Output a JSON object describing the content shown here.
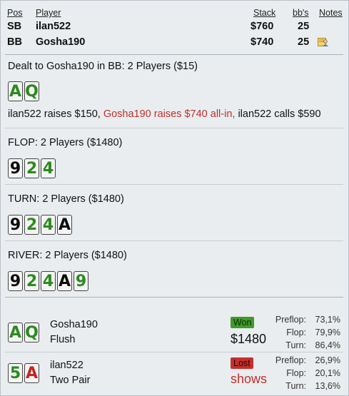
{
  "header": {
    "pos": "Pos",
    "player": "Player",
    "stack": "Stack",
    "bbs": "bb's",
    "notes": "Notes"
  },
  "players": [
    {
      "pos": "SB",
      "name": "ilan522",
      "stack": "$760",
      "bbs": "25"
    },
    {
      "pos": "BB",
      "name": "Gosha190",
      "stack": "$740",
      "bbs": "25",
      "note_icon": "note-person-icon"
    }
  ],
  "preflop": {
    "title": "Dealt to Gosha190 in BB: 2 Players ($15)",
    "hole_cards": [
      {
        "rank": "A",
        "suit": "club"
      },
      {
        "rank": "Q",
        "suit": "club"
      }
    ],
    "action_1": "ilan522 raises $150, ",
    "action_2": "Gosha190 raises $740 all-in, ",
    "action_3": "ilan522 calls $590"
  },
  "flop": {
    "title": "FLOP: 2 Players ($1480)",
    "cards": [
      {
        "rank": "9",
        "suit": "spade"
      },
      {
        "rank": "2",
        "suit": "club"
      },
      {
        "rank": "4",
        "suit": "club"
      }
    ]
  },
  "turn": {
    "title": "TURN: 2 Players ($1480)",
    "cards": [
      {
        "rank": "9",
        "suit": "spade"
      },
      {
        "rank": "2",
        "suit": "club"
      },
      {
        "rank": "4",
        "suit": "club"
      },
      {
        "rank": "A",
        "suit": "spade"
      }
    ]
  },
  "river": {
    "title": "RIVER: 2 Players ($1480)",
    "cards": [
      {
        "rank": "9",
        "suit": "spade"
      },
      {
        "rank": "2",
        "suit": "club"
      },
      {
        "rank": "4",
        "suit": "club"
      },
      {
        "rank": "A",
        "suit": "spade"
      },
      {
        "rank": "9",
        "suit": "club"
      }
    ]
  },
  "results": [
    {
      "cards": [
        {
          "rank": "A",
          "suit": "club"
        },
        {
          "rank": "Q",
          "suit": "club"
        }
      ],
      "name": "Gosha190",
      "hand": "Flush",
      "badge": "Won",
      "amount": "$1480",
      "stats": [
        {
          "k": "Preflop:",
          "v": "73,1%"
        },
        {
          "k": "Flop:",
          "v": "79,9%"
        },
        {
          "k": "Turn:",
          "v": "86,4%"
        }
      ]
    },
    {
      "cards": [
        {
          "rank": "5",
          "suit": "club"
        },
        {
          "rank": "A",
          "suit": "heart"
        }
      ],
      "name": "ilan522",
      "hand": "Two Pair",
      "badge": "Lost",
      "amount": "shows",
      "stats": [
        {
          "k": "Preflop:",
          "v": "26,9%"
        },
        {
          "k": "Flop:",
          "v": "20,1%"
        },
        {
          "k": "Turn:",
          "v": "13,6%"
        }
      ]
    }
  ],
  "colors": {
    "club": "#2c8a1f",
    "spade": "#0b0b0b",
    "heart": "#c8231f",
    "hero_action": "#c1302a",
    "won": "#3f9a2a",
    "lost": "#c4302a"
  }
}
